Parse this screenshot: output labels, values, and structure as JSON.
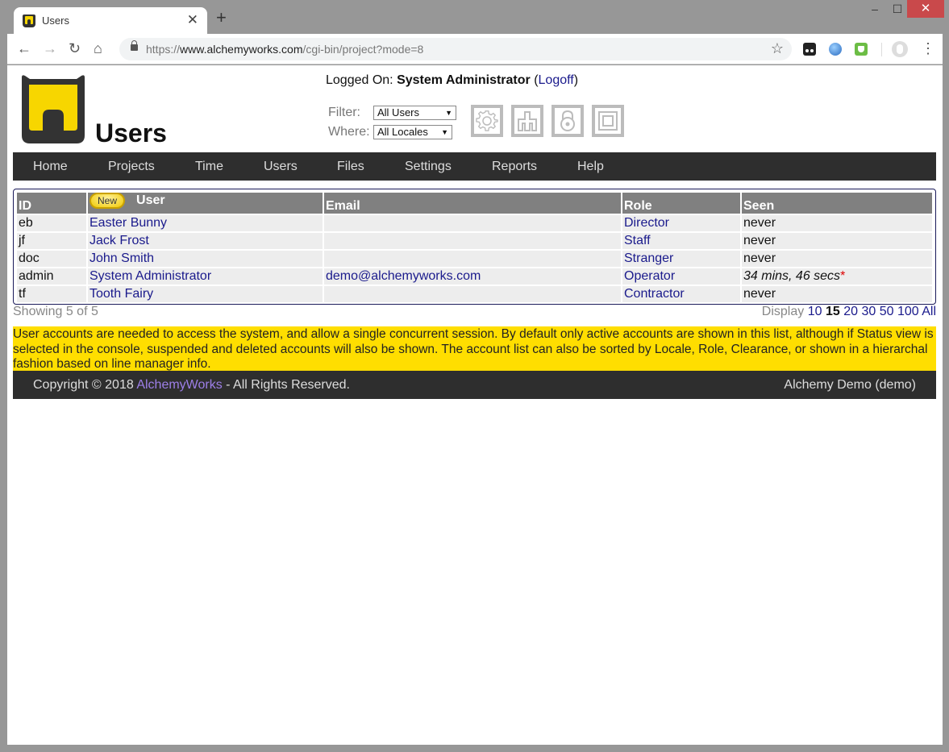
{
  "browser": {
    "tab_title": "Users",
    "url_prefix": "https://",
    "url_host": "www.alchemyworks.com",
    "url_path": "/cgi-bin/project?mode=8",
    "icons": {
      "back": "←",
      "forward": "→",
      "reload": "↻",
      "home": "⌂",
      "star": "☆",
      "close": "✕",
      "new_tab": "+",
      "menu": "⋮",
      "minimize": "–",
      "maximize": "☐",
      "window_close": "✕"
    }
  },
  "header": {
    "page_title": "Users",
    "logged_on_label": "Logged On:",
    "user_name": "System Administrator",
    "logoff_label": "Logoff",
    "filter_label": "Filter:",
    "filter_value": "All Users",
    "where_label": "Where:",
    "where_value": "All Locales",
    "select_arrow": "▼"
  },
  "menu": {
    "items": [
      "Home",
      "Projects",
      "Time",
      "Users",
      "Files",
      "Settings",
      "Reports",
      "Help"
    ]
  },
  "table": {
    "columns": [
      "ID",
      "User",
      "Email",
      "Role",
      "Seen"
    ],
    "new_button": "New",
    "rows": [
      {
        "id": "eb",
        "user": "Easter Bunny",
        "email": "",
        "role": "Director",
        "seen": "never"
      },
      {
        "id": "jf",
        "user": "Jack Frost",
        "email": "",
        "role": "Staff",
        "seen": "never"
      },
      {
        "id": "doc",
        "user": "John Smith",
        "email": "",
        "role": "Stranger",
        "seen": "never"
      },
      {
        "id": "admin",
        "user": "System Administrator",
        "email": "demo@alchemyworks.com",
        "role": "Operator",
        "seen": "34 mins, 46 secs",
        "seen_marker": "*"
      },
      {
        "id": "tf",
        "user": "Tooth Fairy",
        "email": "",
        "role": "Contractor",
        "seen": "never"
      }
    ]
  },
  "pagination": {
    "showing": "Showing 5 of 5",
    "display_label": "Display",
    "options": [
      "10",
      "15",
      "20",
      "30",
      "50",
      "100",
      "All"
    ],
    "selected": "15"
  },
  "info_text": "User accounts are needed to access the system, and allow a single concurrent session. By default only active accounts are shown in this list, although if Status view is selected in the console, suspended and deleted accounts will also be shown. The account list can also be sorted by Locale, Role, Clearance, or shown in a hierarchal fashion based on line manager info.",
  "footer": {
    "copyright_prefix": "Copyright © 2018",
    "company": "AlchemyWorks",
    "copyright_suffix": "- All Rights Reserved.",
    "instance": "Alchemy Demo (demo)"
  },
  "colors": {
    "brand_yellow": "#ffde00",
    "bar_dark": "#2e2e2e",
    "link": "#1a1a8c",
    "table_header": "#808080",
    "row_bg": "#ededed"
  }
}
